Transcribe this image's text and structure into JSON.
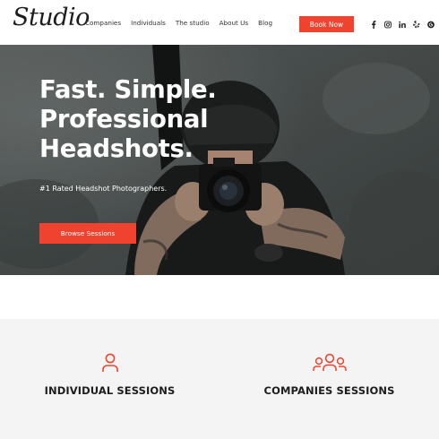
{
  "header": {
    "logo": "Studio",
    "nav": [
      "Companies",
      "Individuals",
      "The studio",
      "About Us",
      "Blog"
    ],
    "book_button": "Book Now",
    "social_icons": [
      "facebook-icon",
      "instagram-icon",
      "linkedin-icon",
      "yelp-icon",
      "google-icon"
    ]
  },
  "hero": {
    "title_lines": [
      "Fast. Simple.",
      "Professional",
      "Headshots."
    ],
    "subtitle": "#1 Rated Headshot Photographers.",
    "cta": "Browse Sessions"
  },
  "sessions": {
    "individual": {
      "label": "INDIVIDUAL SESSIONS",
      "icon": "person-icon"
    },
    "companies": {
      "label": "COMPANIES SESSIONS",
      "icon": "group-icon"
    }
  },
  "colors": {
    "accent": "#f0432f",
    "section_bg": "#f4f4f4",
    "text": "#1d1d1d"
  }
}
